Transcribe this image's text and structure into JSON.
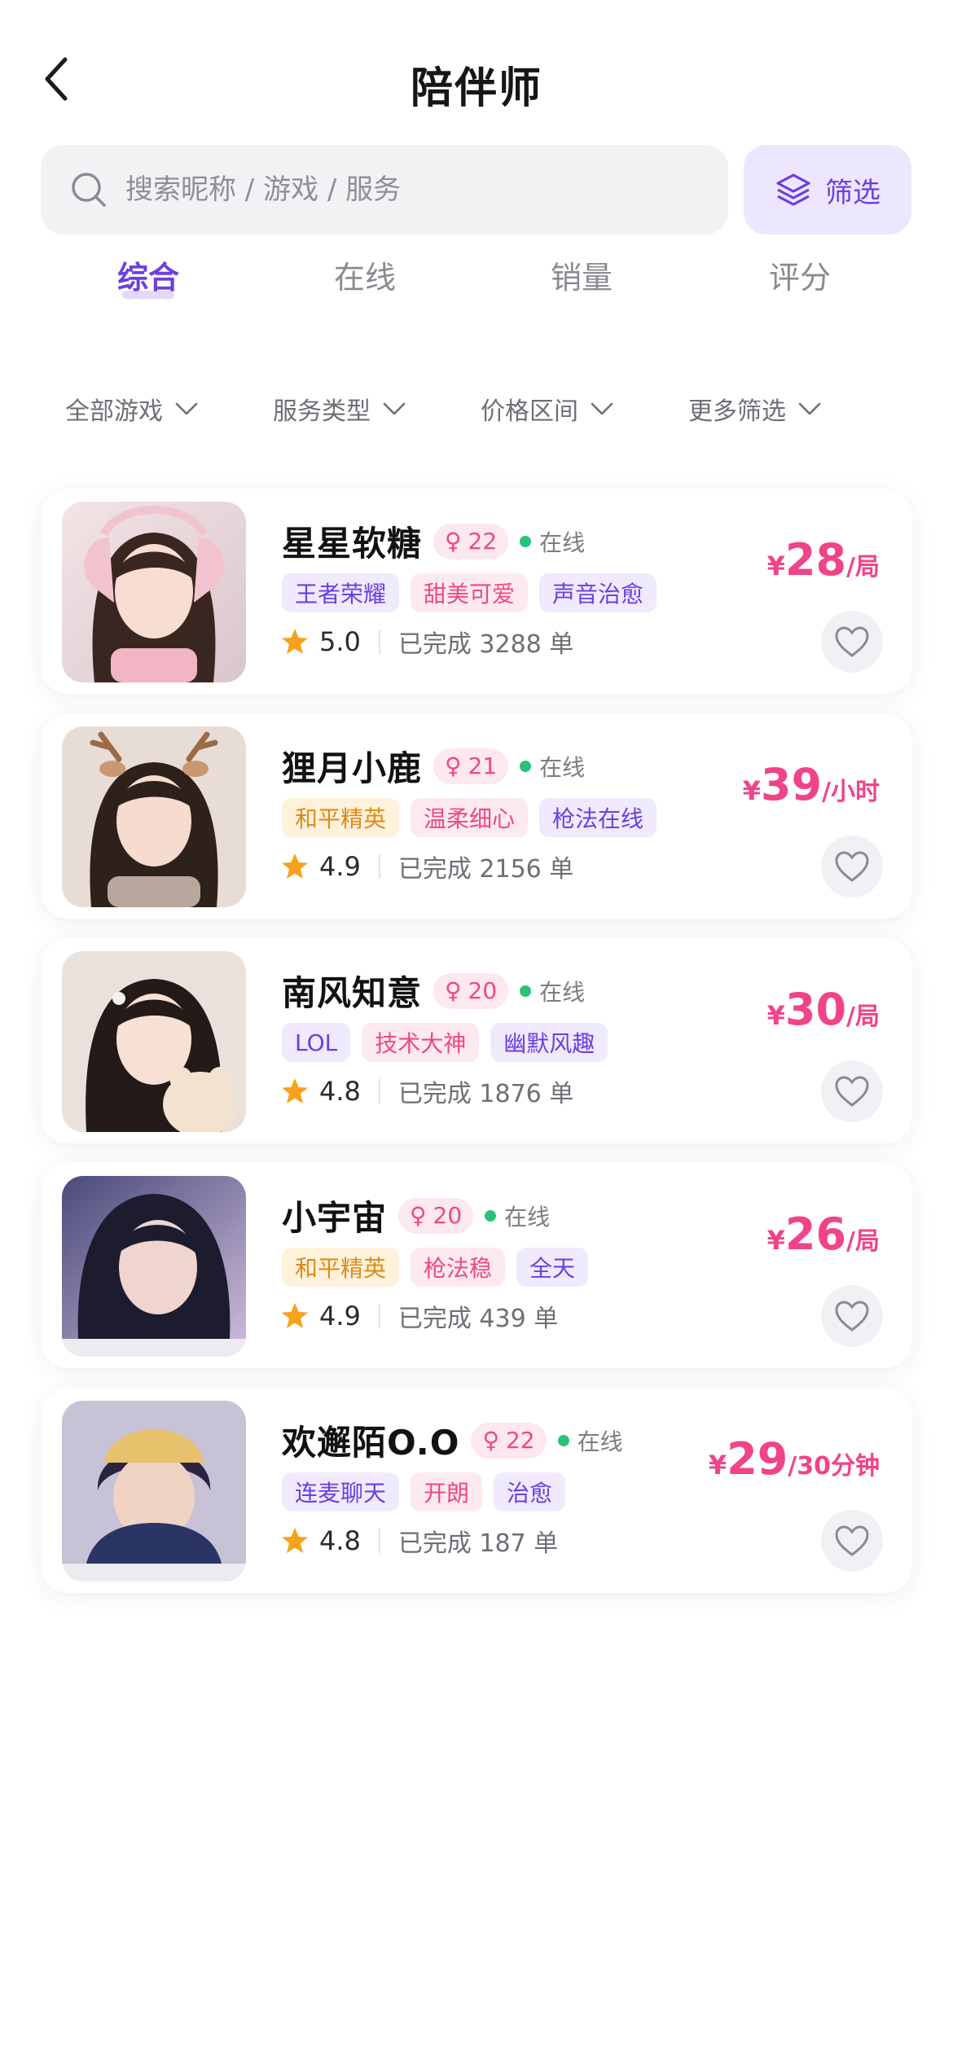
{
  "header": {
    "title": "陪伴师"
  },
  "search": {
    "placeholder": "搜索昵称 / 游戏 / 服务",
    "filter_label": "筛选"
  },
  "tabs": [
    {
      "label": "综合",
      "active": true
    },
    {
      "label": "在线",
      "active": false
    },
    {
      "label": "销量",
      "active": false
    },
    {
      "label": "评分",
      "active": false
    }
  ],
  "sorts": [
    {
      "label": "全部游戏"
    },
    {
      "label": "服务类型"
    },
    {
      "label": "价格区间"
    },
    {
      "label": "更多筛选"
    }
  ],
  "colors": {
    "accent": "#6c3fe0",
    "price": "#f0448a",
    "online": "#2bc17a",
    "star": "#f7a21b"
  },
  "companions": [
    {
      "name": "星星软糖",
      "gender_symbol": "♀",
      "age": "22",
      "status": "在线",
      "tags": [
        {
          "text": "王者荣耀",
          "color": "purple"
        },
        {
          "text": "甜美可爱",
          "color": "pink"
        },
        {
          "text": "声音治愈",
          "color": "purple"
        }
      ],
      "rating": "5.0",
      "completed": "已完成 3288 单",
      "currency": "¥",
      "price": "28",
      "unit": "/局"
    },
    {
      "name": "狸月小鹿",
      "gender_symbol": "♀",
      "age": "21",
      "status": "在线",
      "tags": [
        {
          "text": "和平精英",
          "color": "orange"
        },
        {
          "text": "温柔细心",
          "color": "pink"
        },
        {
          "text": "枪法在线",
          "color": "purple"
        }
      ],
      "rating": "4.9",
      "completed": "已完成 2156 单",
      "currency": "¥",
      "price": "39",
      "unit": "/小时"
    },
    {
      "name": "南风知意",
      "gender_symbol": "♀",
      "age": "20",
      "status": "在线",
      "tags": [
        {
          "text": "LOL",
          "color": "purple"
        },
        {
          "text": "技术大神",
          "color": "pink"
        },
        {
          "text": "幽默风趣",
          "color": "purple"
        }
      ],
      "rating": "4.8",
      "completed": "已完成 1876 单",
      "currency": "¥",
      "price": "30",
      "unit": "/局"
    },
    {
      "name": "小宇宙",
      "gender_symbol": "♀",
      "age": "20",
      "status": "在线",
      "tags": [
        {
          "text": "和平精英",
          "color": "orange"
        },
        {
          "text": "枪法稳",
          "color": "pink"
        },
        {
          "text": "全天",
          "color": "purple"
        }
      ],
      "rating": "4.9",
      "completed": "已完成 439 单",
      "currency": "¥",
      "price": "26",
      "unit": "/局"
    },
    {
      "name": "欢邂陌O.O",
      "gender_symbol": "♀",
      "age": "22",
      "status": "在线",
      "tags": [
        {
          "text": "连麦聊天",
          "color": "purple"
        },
        {
          "text": "开朗",
          "color": "pink"
        },
        {
          "text": "治愈",
          "color": "purple"
        }
      ],
      "rating": "4.8",
      "completed": "已完成 187 单",
      "currency": "¥",
      "price": "29",
      "unit": "/30分钟"
    }
  ]
}
